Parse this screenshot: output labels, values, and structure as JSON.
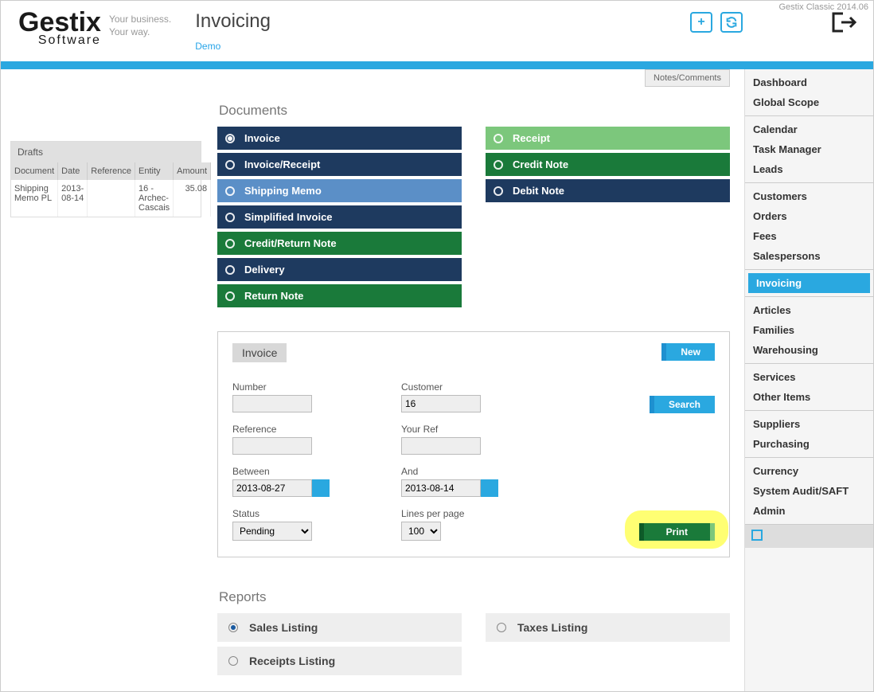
{
  "version": "Gestix Classic 2014.06",
  "logo": {
    "main": "Gestix",
    "sub": "Software",
    "tag1": "Your business.",
    "tag2": "Your way."
  },
  "page": {
    "title": "Invoicing",
    "demo": "Demo"
  },
  "notes_btn": "Notes/Comments",
  "drafts": {
    "title": "Drafts",
    "cols": [
      "Document",
      "Date",
      "Reference",
      "Entity",
      "Amount"
    ],
    "rows": [
      {
        "doc": "Shipping Memo PL",
        "date": "2013-08-14",
        "ref": "",
        "entity": "16 - Archec-Cascais",
        "amount": "35.08"
      }
    ]
  },
  "documents": {
    "heading": "Documents",
    "left": [
      {
        "label": "Invoice",
        "cls": "bg-navy",
        "sel": true
      },
      {
        "label": "Invoice/Receipt",
        "cls": "bg-navy",
        "sel": false
      },
      {
        "label": "Shipping Memo",
        "cls": "bg-blue",
        "sel": false
      },
      {
        "label": "Simplified Invoice",
        "cls": "bg-navy",
        "sel": false
      },
      {
        "label": "Credit/Return Note",
        "cls": "bg-green",
        "sel": false
      },
      {
        "label": "Delivery",
        "cls": "bg-navy",
        "sel": false
      },
      {
        "label": "Return Note",
        "cls": "bg-green",
        "sel": false
      }
    ],
    "right": [
      {
        "label": "Receipt",
        "cls": "bg-lgreen",
        "sel": false
      },
      {
        "label": "Credit Note",
        "cls": "bg-green",
        "sel": false
      },
      {
        "label": "Debit Note",
        "cls": "bg-navy",
        "sel": false
      }
    ]
  },
  "filter": {
    "tag": "Invoice",
    "new_btn": "New",
    "search_btn": "Search",
    "print_btn": "Print",
    "number_lbl": "Number",
    "number_val": "",
    "reference_lbl": "Reference",
    "reference_val": "",
    "between_lbl": "Between",
    "between_val": "2013-08-27",
    "status_lbl": "Status",
    "status_val": "Pending",
    "customer_lbl": "Customer",
    "customer_val": "16",
    "yourref_lbl": "Your Ref",
    "yourref_val": "",
    "and_lbl": "And",
    "and_val": "2013-08-14",
    "lpp_lbl": "Lines per page",
    "lpp_val": "100"
  },
  "reports": {
    "heading": "Reports",
    "left": [
      {
        "label": "Sales Listing",
        "sel": true
      },
      {
        "label": "Receipts Listing",
        "sel": false
      }
    ],
    "right": [
      {
        "label": "Taxes Listing",
        "sel": false
      }
    ]
  },
  "menu": [
    [
      "Dashboard",
      "Global Scope"
    ],
    [
      "Calendar",
      "Task Manager",
      "Leads"
    ],
    [
      "Customers",
      "Orders",
      "Fees",
      "Salespersons"
    ],
    [
      "Invoicing"
    ],
    [
      "Articles",
      "Families",
      "Warehousing"
    ],
    [
      "Services",
      "Other Items"
    ],
    [
      "Suppliers",
      "Purchasing"
    ],
    [
      "Currency",
      "System Audit/SAFT",
      "Admin"
    ]
  ],
  "menu_active": "Invoicing"
}
